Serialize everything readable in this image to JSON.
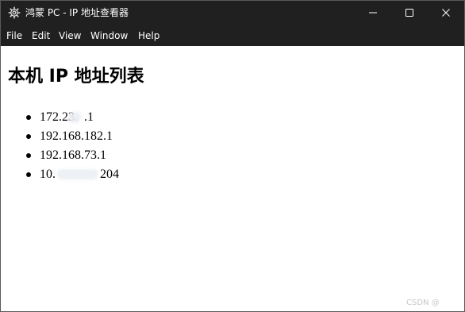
{
  "window": {
    "title": "鸿蒙 PC - IP 地址查看器",
    "app_icon": "settings-gear-icon",
    "controls": {
      "minimize_icon": "minimize-icon",
      "maximize_icon": "maximize-icon",
      "close_icon": "close-icon"
    }
  },
  "menubar": {
    "items": [
      {
        "label": "File"
      },
      {
        "label": "Edit"
      },
      {
        "label": "View"
      },
      {
        "label": "Window"
      },
      {
        "label": "Help"
      }
    ]
  },
  "content": {
    "heading": "本机 IP 地址列表",
    "ip_addresses": [
      {
        "text": "172.23.",
        "suffix": ".1",
        "redacted": true
      },
      {
        "text": "192.168.182.1",
        "suffix": "",
        "redacted": false
      },
      {
        "text": "192.168.73.1",
        "suffix": "",
        "redacted": false
      },
      {
        "text": "10.",
        "suffix": "204",
        "redacted": true
      }
    ]
  },
  "watermark": "CSDN @",
  "colors": {
    "titlebar_bg": "#202020",
    "menubar_bg": "#202020",
    "content_bg": "#ffffff",
    "text": "#000000",
    "chrome_text": "#ffffff"
  }
}
